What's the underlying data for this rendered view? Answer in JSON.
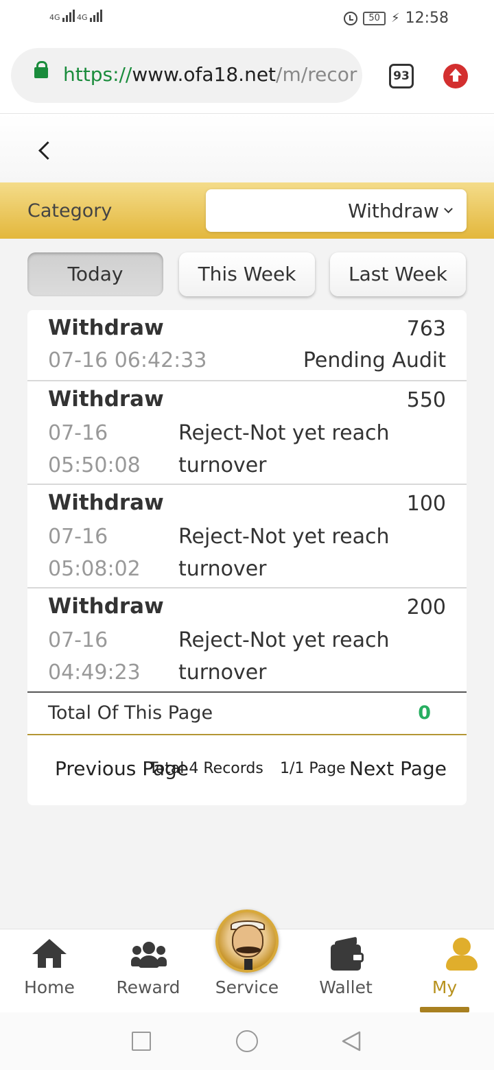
{
  "status_bar": {
    "signal1": "4G",
    "signal2": "4G",
    "battery": "50",
    "time": "12:58"
  },
  "browser": {
    "url_scheme": "https://",
    "url_host": "www.ofa18.net",
    "url_path": "/m/recor",
    "tab_count": "93"
  },
  "category": {
    "label": "Category",
    "selected": "Withdraw"
  },
  "period_tabs": [
    {
      "label": "Today",
      "active": true
    },
    {
      "label": "This Week",
      "active": false
    },
    {
      "label": "Last Week",
      "active": false
    }
  ],
  "records": [
    {
      "type": "Withdraw",
      "amount": "763",
      "date": "07-16 06:42:33",
      "status": "Pending Audit"
    },
    {
      "type": "Withdraw",
      "amount": "550",
      "date": "07-16",
      "time": "05:50:08",
      "status_line1": "Reject-Not yet reach",
      "status_line2": "turnover"
    },
    {
      "type": "Withdraw",
      "amount": "100",
      "date": "07-16",
      "time": "05:08:02",
      "status_line1": "Reject-Not yet reach",
      "status_line2": "turnover"
    },
    {
      "type": "Withdraw",
      "amount": "200",
      "date": "07-16",
      "time": "04:49:23",
      "status_line1": "Reject-Not yet reach",
      "status_line2": "turnover"
    }
  ],
  "total": {
    "label": "Total Of This Page",
    "value": "0"
  },
  "pager": {
    "prev": "Previous Page",
    "records_total": "Total 4 Records",
    "page": "1/1 Page",
    "next": "Next Page"
  },
  "nav": [
    {
      "label": "Home",
      "icon": "home-icon"
    },
    {
      "label": "Reward",
      "icon": "users-icon"
    },
    {
      "label": "Service",
      "icon": "service-avatar"
    },
    {
      "label": "Wallet",
      "icon": "wallet-icon"
    },
    {
      "label": "My",
      "icon": "user-icon",
      "active": true
    }
  ],
  "colors": {
    "accent_gold": "#e3b73c",
    "total_green": "#27ae60",
    "active_nav": "#b8921e"
  }
}
